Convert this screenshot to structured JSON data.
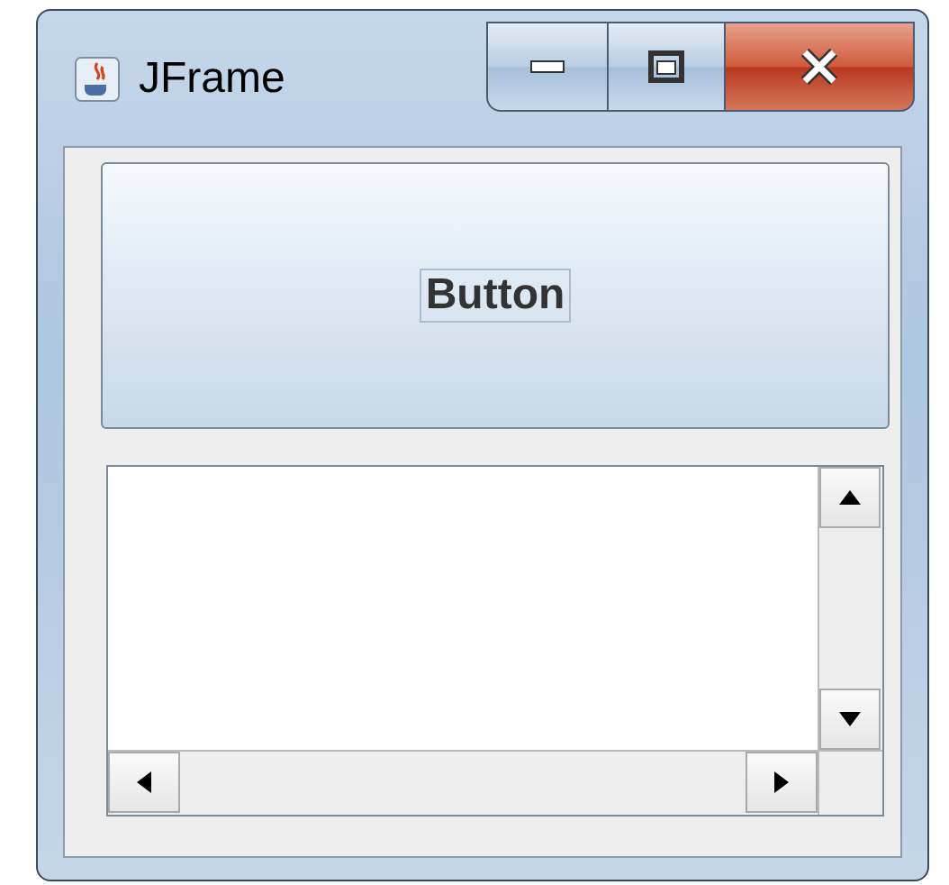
{
  "window": {
    "title": "JFrame"
  },
  "button": {
    "label": "Button"
  }
}
